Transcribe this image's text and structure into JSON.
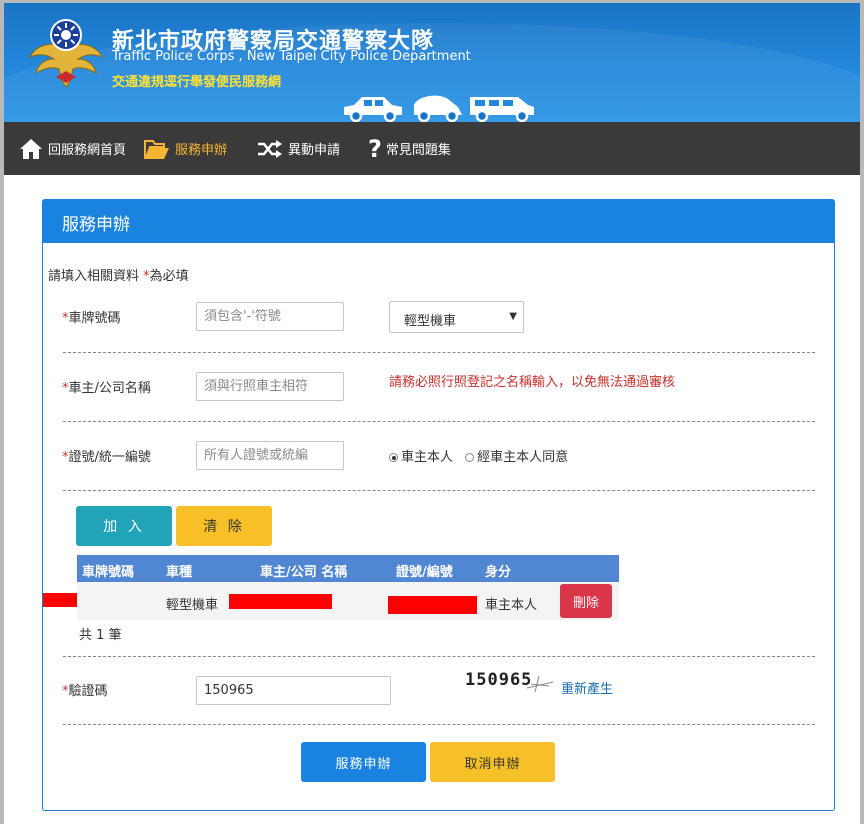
{
  "header": {
    "title_cn": "新北市政府警察局交通警察大隊",
    "title_en": "Traffic Police Corps , New Taipei City Police Department",
    "subtitle": "交通違規逕行舉發便民服務網"
  },
  "nav": {
    "home": "回服務網首頁",
    "service": "服務申辦",
    "change": "異動申請",
    "faq": "常見問題集"
  },
  "panel": {
    "title": "服務申辦",
    "instructions_prefix": "請填入相關資料 ",
    "instructions_star": "*",
    "instructions_suffix": "為必填"
  },
  "form": {
    "star": "*",
    "plate_label": "車牌號碼",
    "plate_placeholder": "須包含'-'符號",
    "vehicle_type": "輕型機車",
    "owner_label": "車主/公司名稱",
    "owner_placeholder": "須與行照車主相符",
    "owner_warning": "請務必照行照登記之名稱輸入，以免無法通過審核",
    "id_label": "證號/統一編號",
    "id_placeholder": "所有人證號或統編",
    "radio_self": "車主本人",
    "radio_consent": "經車主本人同意",
    "add_button": "加 入",
    "clear_button": "清 除",
    "captcha_label": "驗證碼",
    "captcha_value": "150965",
    "captcha_image_text": "150965",
    "regenerate": "重新產生",
    "submit_button": "服務申辦",
    "cancel_button": "取消申辦"
  },
  "table": {
    "headers": [
      "車牌號碼",
      "車種",
      "車主/公司 名稱",
      "證號/編號",
      "身分"
    ],
    "rows": [
      {
        "type": "輕型機車",
        "identity": "車主本人",
        "delete": "刪除"
      }
    ],
    "total": "共 1 筆"
  },
  "colors": {
    "header_blue": "#1a83df",
    "nav_dark": "#3a3a3a",
    "accent_yellow": "#f5b531",
    "teal": "#22a4b8",
    "danger": "#d9364a"
  }
}
